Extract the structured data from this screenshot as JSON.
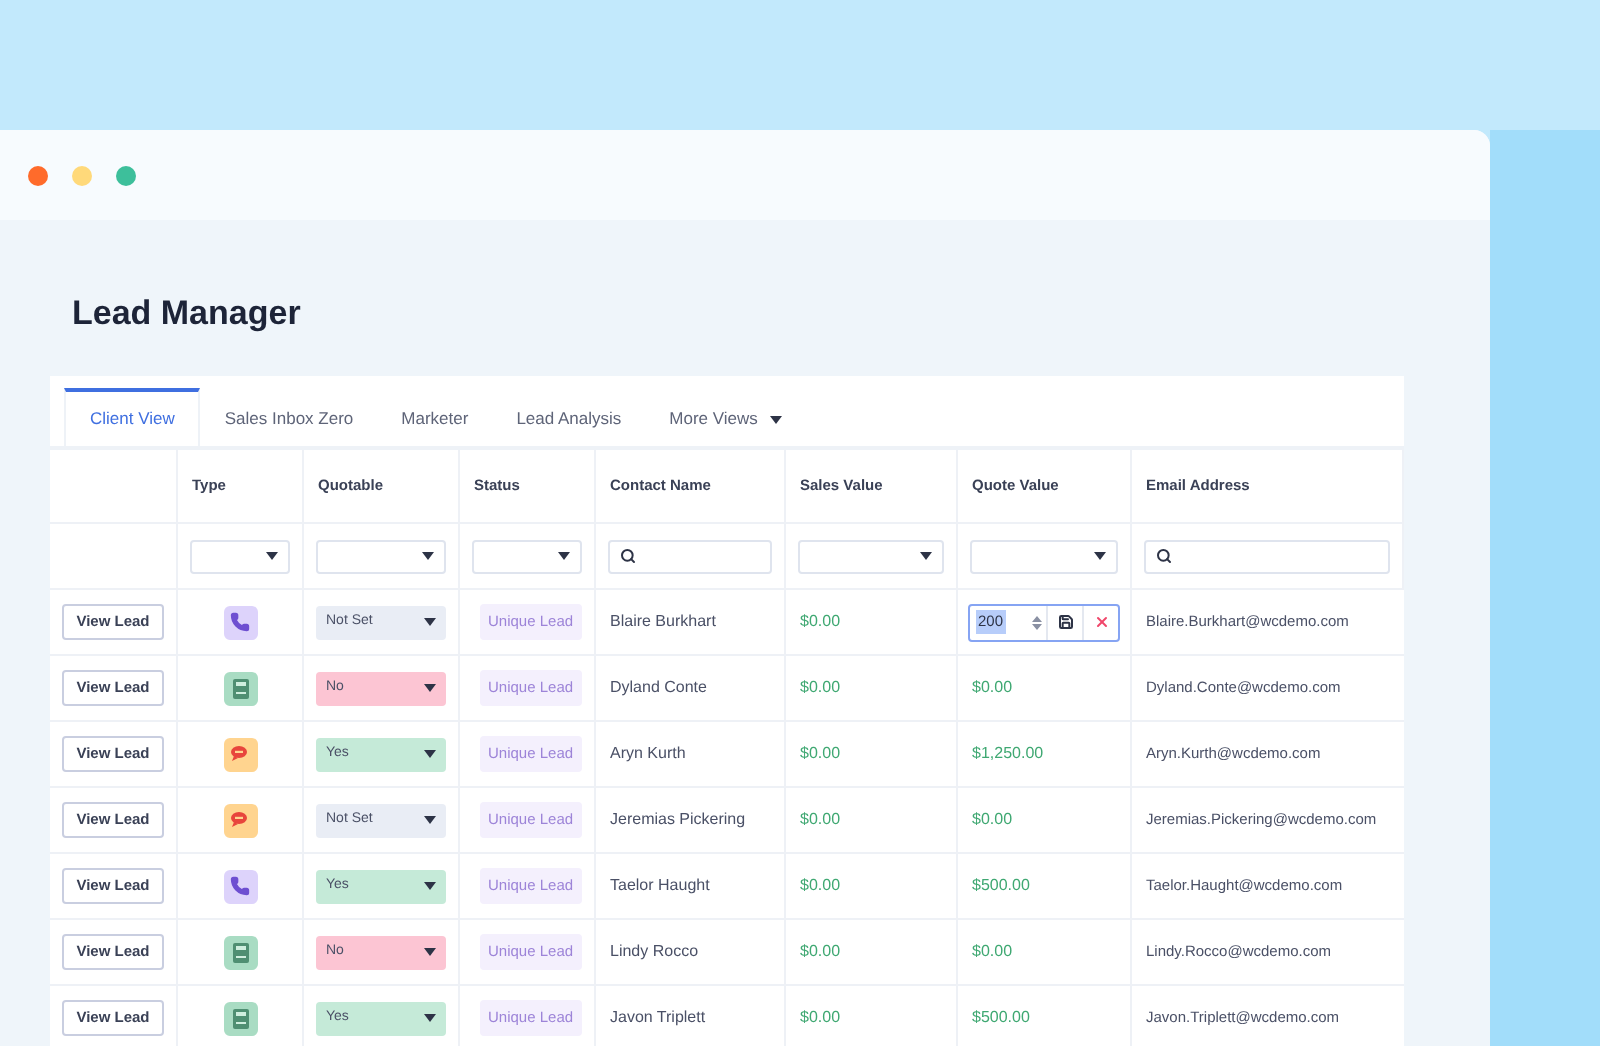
{
  "window": {
    "title": "Lead Manager"
  },
  "tabs": [
    {
      "label": "Client View",
      "selected": true
    },
    {
      "label": "Sales Inbox Zero",
      "selected": false
    },
    {
      "label": "Marketer",
      "selected": false
    },
    {
      "label": "Lead Analysis",
      "selected": false
    },
    {
      "label": "More Views",
      "selected": false,
      "dropdown": true
    }
  ],
  "columns": [
    {
      "label": "Type",
      "kind": "select"
    },
    {
      "label": "Quotable",
      "kind": "select"
    },
    {
      "label": "Status",
      "kind": "select"
    },
    {
      "label": "Contact Name",
      "kind": "search"
    },
    {
      "label": "Sales Value",
      "kind": "select"
    },
    {
      "label": "Quote Value",
      "kind": "select"
    },
    {
      "label": "Email Address",
      "kind": "search"
    }
  ],
  "rows": [
    {
      "action": "View Lead",
      "kind": "phone",
      "quotable": {
        "label": "Not Set",
        "color": "#e9edf5"
      },
      "status": "Unique Lead",
      "contact": "Blaire Burkhart",
      "sales": "$0.00",
      "quote": {
        "value": "200",
        "editing": true
      },
      "email": "Blaire.Burkhart@wcdemo.com"
    },
    {
      "action": "View Lead",
      "kind": "form",
      "quotable": {
        "label": "No",
        "color": "#fcc5d3"
      },
      "status": "Unique Lead",
      "contact": "Dyland Conte",
      "sales": "$0.00",
      "quote": {
        "value": "$0.00",
        "editing": false
      },
      "email": "Dyland.Conte@wcdemo.com"
    },
    {
      "action": "View Lead",
      "kind": "chat",
      "quotable": {
        "label": "Yes",
        "color": "#c5ead8"
      },
      "status": "Unique Lead",
      "contact": "Aryn Kurth",
      "sales": "$0.00",
      "quote": {
        "value": "$1,250.00",
        "editing": false
      },
      "email": "Aryn.Kurth@wcdemo.com"
    },
    {
      "action": "View Lead",
      "kind": "chat",
      "quotable": {
        "label": "Not Set",
        "color": "#e9edf5"
      },
      "status": "Unique Lead",
      "contact": "Jeremias Pickering",
      "sales": "$0.00",
      "quote": {
        "value": "$0.00",
        "editing": false
      },
      "email": "Jeremias.Pickering@wcdemo.com"
    },
    {
      "action": "View Lead",
      "kind": "phone",
      "quotable": {
        "label": "Yes",
        "color": "#c5ead8"
      },
      "status": "Unique Lead",
      "contact": "Taelor Haught",
      "sales": "$0.00",
      "quote": {
        "value": "$500.00",
        "editing": false
      },
      "email": "Taelor.Haught@wcdemo.com"
    },
    {
      "action": "View Lead",
      "kind": "form",
      "quotable": {
        "label": "No",
        "color": "#fcc5d3"
      },
      "status": "Unique Lead",
      "contact": "Lindy Rocco",
      "sales": "$0.00",
      "quote": {
        "value": "$0.00",
        "editing": false
      },
      "email": "Lindy.Rocco@wcdemo.com"
    },
    {
      "action": "View Lead",
      "kind": "form",
      "quotable": {
        "label": "Yes",
        "color": "#c5ead8"
      },
      "status": "Unique Lead",
      "contact": "Javon Triplett",
      "sales": "$0.00",
      "quote": {
        "value": "$500.00",
        "editing": false
      },
      "email": "Javon.Triplett@wcdemo.com"
    }
  ]
}
